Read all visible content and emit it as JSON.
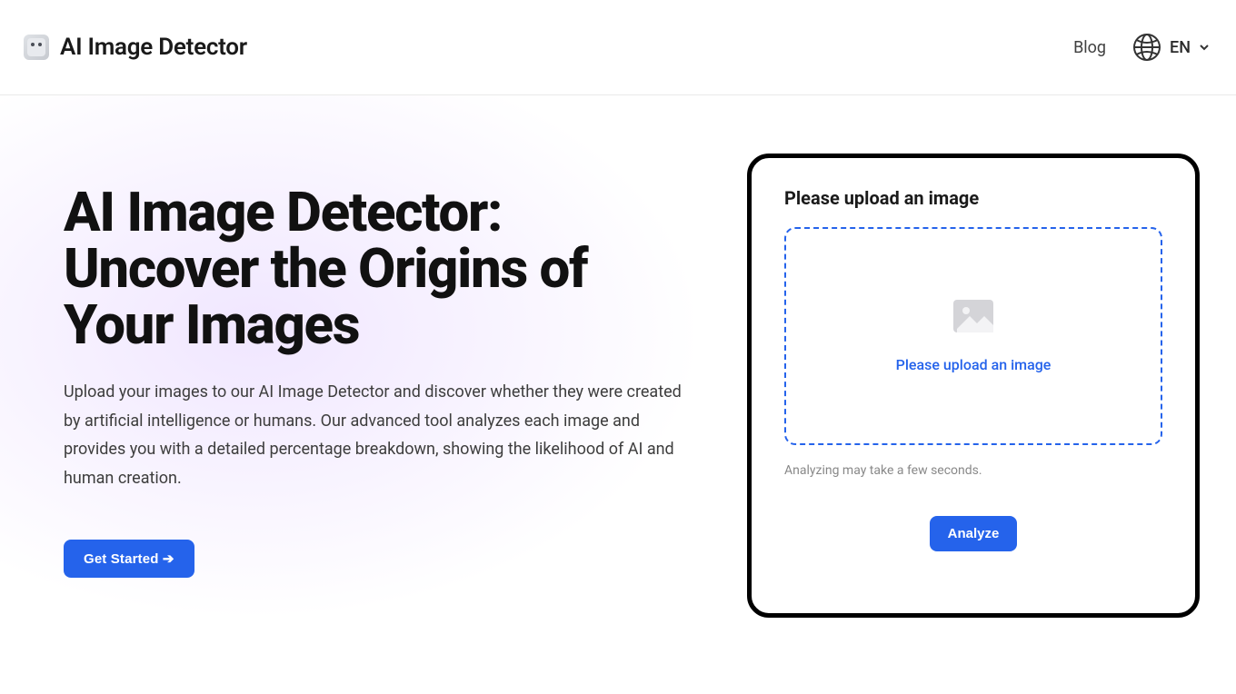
{
  "header": {
    "brand_name": "AI Image Detector",
    "nav": {
      "blog": "Blog"
    },
    "language": {
      "code": "EN"
    }
  },
  "hero": {
    "title": "AI Image Detector: Uncover the Origins of Your Images",
    "description": "Upload your images to our AI Image Detector and discover whether they were created by artificial intelligence or humans. Our advanced tool analyzes each image and provides you with a detailed percentage breakdown, showing the likelihood of AI and human creation.",
    "cta_label": "Get Started ➔"
  },
  "upload": {
    "card_title": "Please upload an image",
    "dropzone_text": "Please upload an image",
    "note": "Analyzing may take a few seconds.",
    "analyze_label": "Analyze"
  },
  "colors": {
    "accent": "#2563eb",
    "border_strong": "#000000",
    "text_primary": "#111111",
    "text_muted": "#888888"
  }
}
